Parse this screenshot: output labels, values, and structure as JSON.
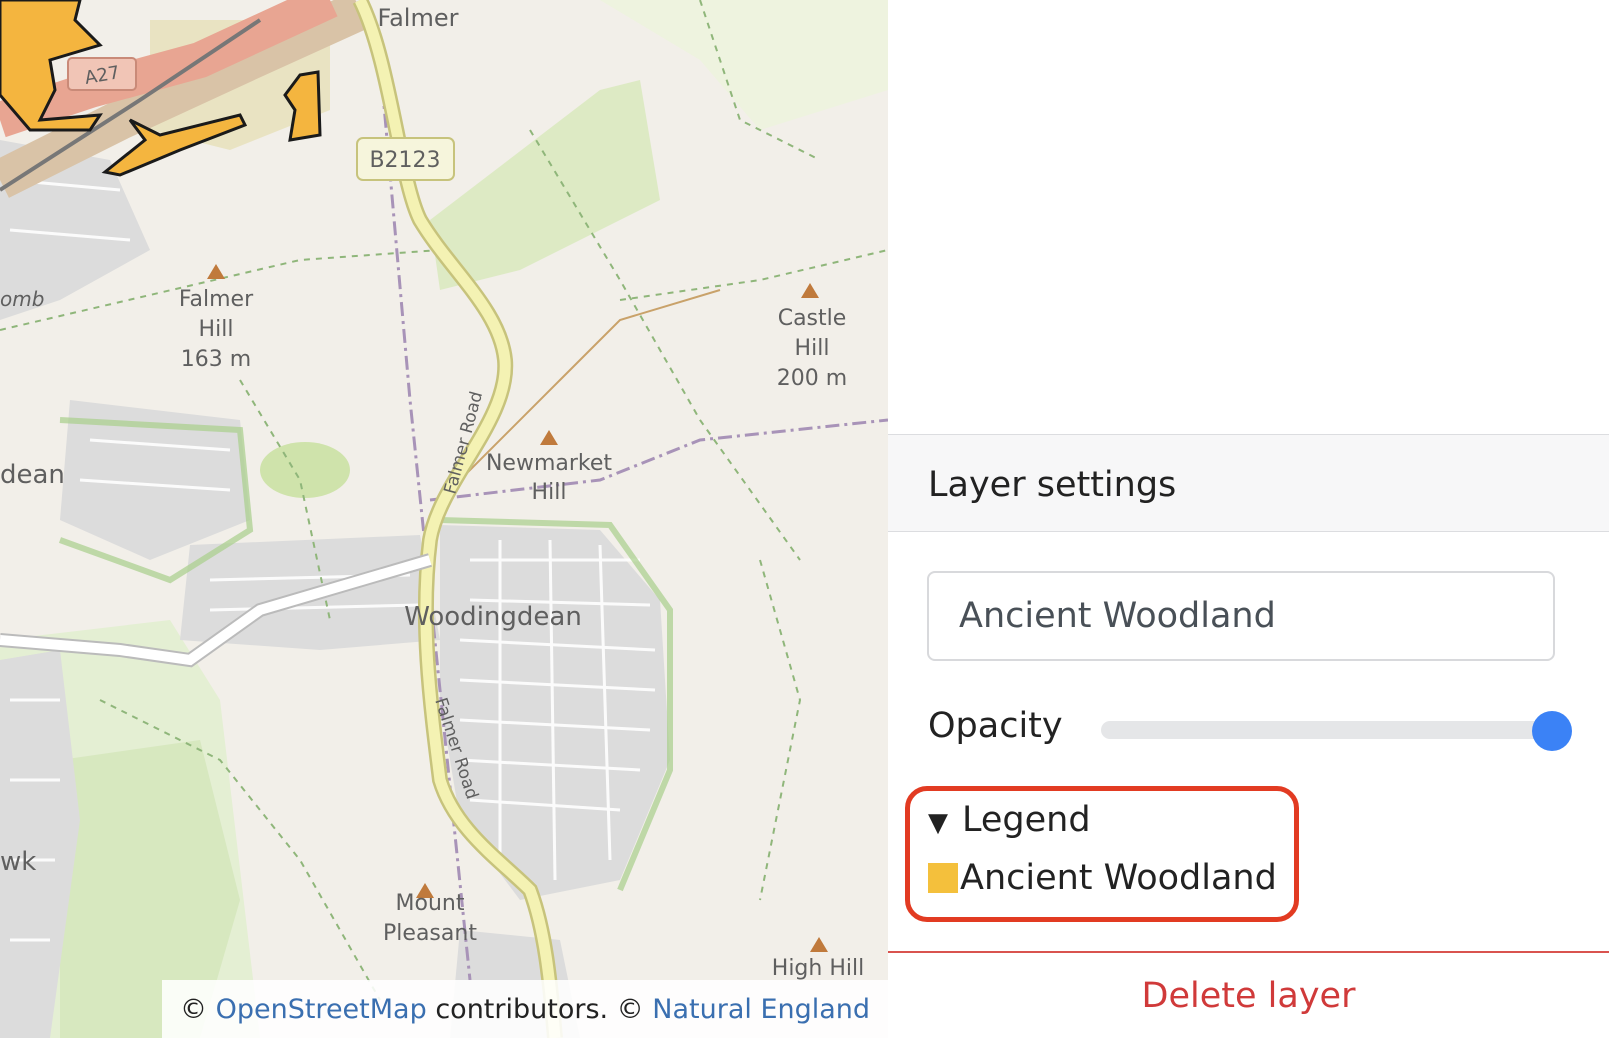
{
  "map": {
    "labels": {
      "falmer": "Falmer",
      "road_b2123": "B2123",
      "road_a27": "A27",
      "falmer_hill_name1": "Falmer",
      "falmer_hill_name2": "Hill",
      "falmer_hill_height": "163 m",
      "castle_hill_name1": "Castle",
      "castle_hill_name2": "Hill",
      "castle_hill_height": "200 m",
      "newmarket_hill_name1": "Newmarket",
      "newmarket_hill_name2": "Hill",
      "woodingdean": "Woodingdean",
      "falmer_road_1": "Falmer Road",
      "falmer_road_2": "Falmer Road",
      "mount_pleasant_1": "Mount",
      "mount_pleasant_2": "Pleasant",
      "high_hill": "High Hill",
      "partial_dean": "dean",
      "partial_comb": "omb",
      "partial_hawk": "wk"
    },
    "attribution": {
      "prefix": "©",
      "osm_link": "OpenStreetMap",
      "middle": "contributors. ©",
      "ne_link": "Natural England"
    },
    "colors": {
      "background": "#f2efe9",
      "woodland_fill": "#f4b53f",
      "woodland_stroke": "#1a1a1a",
      "park": "#d9e9bd",
      "road_major": "#e8a592",
      "road_secondary": "#f4f2b3"
    }
  },
  "panel": {
    "title": "Layer settings",
    "name_input_value": "Ancient Woodland",
    "opacity_label": "Opacity",
    "opacity_value": 1.0,
    "legend": {
      "summary_icon": "▼",
      "summary_label": "Legend",
      "items": [
        {
          "label": "Ancient Woodland",
          "color": "#f4c03c"
        }
      ]
    },
    "delete_label": "Delete layer",
    "accent_color": "#3b82f6",
    "danger_color": "#d03a3a"
  }
}
